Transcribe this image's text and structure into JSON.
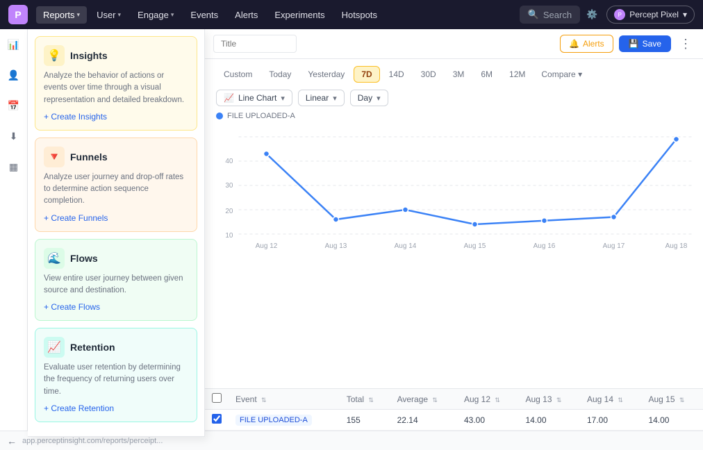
{
  "nav": {
    "logo_text": "P",
    "items": [
      {
        "label": "Reports",
        "active": true,
        "has_dropdown": true
      },
      {
        "label": "User",
        "has_dropdown": true
      },
      {
        "label": "Engage",
        "has_dropdown": true
      },
      {
        "label": "Events"
      },
      {
        "label": "Alerts"
      },
      {
        "label": "Experiments"
      },
      {
        "label": "Hotspots"
      }
    ],
    "search_placeholder": "Search",
    "settings_label": "Settings",
    "account_name": "Percept Pixel",
    "account_initial": "P"
  },
  "sidebar_icons": [
    "📊",
    "👤",
    "📅",
    "🔽",
    "🔲"
  ],
  "dropdown": {
    "sections": [
      {
        "id": "insights",
        "title": "Insights",
        "icon": "💡",
        "theme": "yellow",
        "description": "Analyze the behavior of actions or events over time through a visual representation and detailed breakdown.",
        "create_label": "+ Create Insights"
      },
      {
        "id": "funnels",
        "title": "Funnels",
        "icon": "🔻",
        "theme": "orange",
        "description": "Analyze user journey and drop-off rates to determine action sequence completion.",
        "create_label": "+ Create Funnels"
      },
      {
        "id": "flows",
        "title": "Flows",
        "icon": "🌊",
        "theme": "green",
        "description": "View entire user journey between given source and destination.",
        "create_label": "+ Create Flows"
      },
      {
        "id": "retention",
        "title": "Retention",
        "icon": "📈",
        "theme": "teal",
        "description": "Evaluate user retention by determining the frequency of returning users over time.",
        "create_label": "+ Create Retention"
      }
    ]
  },
  "topbar": {
    "title_placeholder": "Title",
    "alerts_label": "Alerts",
    "save_label": "Save"
  },
  "date_tabs": [
    "Custom",
    "Today",
    "Yesterday",
    "7D",
    "14D",
    "30D",
    "3M",
    "6M",
    "12M",
    "Compare ▾"
  ],
  "active_date_tab": "7D",
  "chart_controls": {
    "chart_type_label": "Line Chart",
    "scale_label": "Linear",
    "interval_label": "Day"
  },
  "legend": {
    "color": "#3b82f6",
    "label": "FILE UPLOADED-A"
  },
  "chart": {
    "y_labels": [
      "10",
      "20",
      "30",
      "40"
    ],
    "x_labels": [
      "Aug 12",
      "Aug 13",
      "Aug 14",
      "Aug 15",
      "Aug 16",
      "Aug 17",
      "Aug 18"
    ],
    "data_points": [
      {
        "x": 0,
        "y": 43
      },
      {
        "x": 1,
        "y": 16
      },
      {
        "x": 2,
        "y": 20
      },
      {
        "x": 3,
        "y": 14
      },
      {
        "x": 4,
        "y": 15.5
      },
      {
        "x": 5,
        "y": 17
      },
      {
        "x": 6,
        "y": 49
      }
    ]
  },
  "table": {
    "columns": [
      {
        "label": "Event",
        "sortable": true
      },
      {
        "label": "Total",
        "sortable": true
      },
      {
        "label": "Average",
        "sortable": true
      },
      {
        "label": "Aug 12",
        "sortable": true
      },
      {
        "label": "Aug 13",
        "sortable": true
      },
      {
        "label": "Aug 14",
        "sortable": true
      },
      {
        "label": "Aug 15",
        "sortable": true
      }
    ],
    "rows": [
      {
        "checked": true,
        "event": "FILE UPLOADED-A",
        "total": "155",
        "average": "22.14",
        "aug12": "43.00",
        "aug13": "14.00",
        "aug14": "17.00",
        "aug15": "14.00"
      }
    ]
  },
  "bottom_bar": {
    "url": "app.perceptinsight.com/reports/perceipt..."
  }
}
